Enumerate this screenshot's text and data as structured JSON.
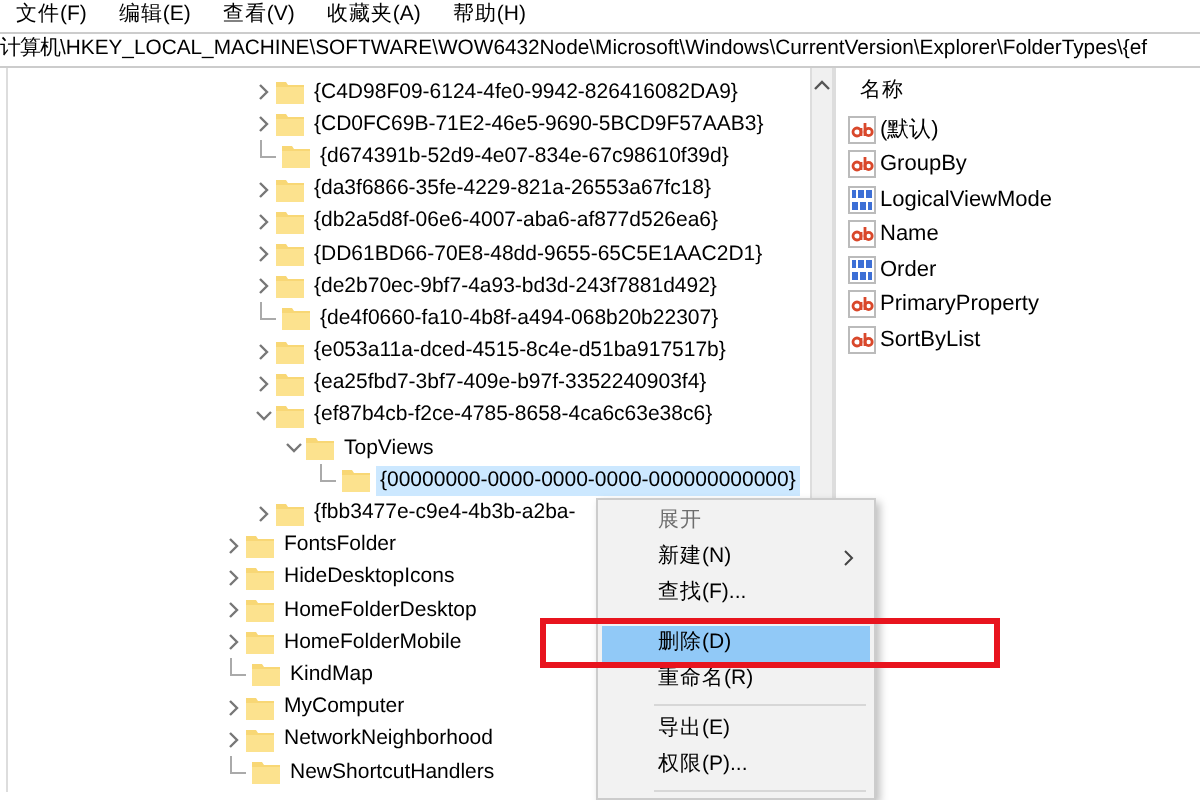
{
  "menu_bar": [
    "文件(F)",
    "编辑(E)",
    "查看(V)",
    "收藏夹(A)",
    "帮助(H)"
  ],
  "address": "计算机\\HKEY_LOCAL_MACHINE\\SOFTWARE\\WOW6432Node\\Microsoft\\Windows\\CurrentVersion\\Explorer\\FolderTypes\\{ef",
  "tree": {
    "continued": [
      {
        "label": "{C4D98F09-6124-4fe0-9942-826416082DA9}",
        "kind": "collapsed",
        "selected": false
      },
      {
        "label": "{CD0FC69B-71E2-46e5-9690-5BCD9F57AAB3}",
        "kind": "collapsed",
        "selected": false
      },
      {
        "label": "{d674391b-52d9-4e07-834e-67c98610f39d}",
        "kind": "leaf",
        "selected": false
      },
      {
        "label": "{da3f6866-35fe-4229-821a-26553a67fc18}",
        "kind": "collapsed",
        "selected": false
      },
      {
        "label": "{db2a5d8f-06e6-4007-aba6-af877d526ea6}",
        "kind": "collapsed",
        "selected": false
      },
      {
        "label": "{DD61BD66-70E8-48dd-9655-65C5E1AAC2D1}",
        "kind": "collapsed",
        "selected": false
      },
      {
        "label": "{de2b70ec-9bf7-4a93-bd3d-243f7881d492}",
        "kind": "collapsed",
        "selected": false
      },
      {
        "label": "{de4f0660-fa10-4b8f-a494-068b20b22307}",
        "kind": "leaf",
        "selected": false
      },
      {
        "label": "{e053a11a-dced-4515-8c4e-d51ba917517b}",
        "kind": "collapsed",
        "selected": false
      },
      {
        "label": "{ea25fbd7-3bf7-409e-b97f-3352240903f4}",
        "kind": "collapsed",
        "selected": false
      },
      {
        "label": "{ef87b4cb-f2ce-4785-8658-4ca6c63e38c6}",
        "kind": "expanded",
        "selected": false,
        "children": [
          {
            "label": "TopViews",
            "kind": "expanded",
            "selected": false,
            "children": [
              {
                "label": "{00000000-0000-0000-0000-000000000000}",
                "kind": "leaf",
                "selected": true
              }
            ]
          }
        ]
      },
      {
        "label": "{fbb3477e-c9e4-4b3b-a2ba-",
        "kind": "collapsed",
        "selected": false
      }
    ],
    "items": [
      {
        "label": "FontsFolder",
        "kind": "collapsed",
        "selected": false
      },
      {
        "label": "HideDesktopIcons",
        "kind": "collapsed",
        "selected": false
      },
      {
        "label": "HomeFolderDesktop",
        "kind": "collapsed",
        "selected": false
      },
      {
        "label": "HomeFolderMobile",
        "kind": "collapsed",
        "selected": false
      },
      {
        "label": "KindMap",
        "kind": "leaf",
        "selected": false
      },
      {
        "label": "MyComputer",
        "kind": "collapsed",
        "selected": false
      },
      {
        "label": "NetworkNeighborhood",
        "kind": "collapsed",
        "selected": false
      },
      {
        "label": "NewShortcutHandlers",
        "kind": "leaf",
        "selected": false
      }
    ]
  },
  "values": {
    "column": "名称",
    "rows": [
      {
        "name": "(默认)",
        "kind": "string"
      },
      {
        "name": "GroupBy",
        "kind": "string"
      },
      {
        "name": "LogicalViewMode",
        "kind": "binary"
      },
      {
        "name": "Name",
        "kind": "string"
      },
      {
        "name": "Order",
        "kind": "binary"
      },
      {
        "name": "PrimaryProperty",
        "kind": "string"
      },
      {
        "name": "SortByList",
        "kind": "string"
      }
    ]
  },
  "context_menu": [
    {
      "kind": "item",
      "label": "展开",
      "disabled": true,
      "submenu": false,
      "selected": false
    },
    {
      "kind": "item",
      "label": "新建(N)",
      "disabled": false,
      "submenu": true,
      "selected": false
    },
    {
      "kind": "item",
      "label": "查找(F)...",
      "disabled": false,
      "submenu": false,
      "selected": false
    },
    {
      "kind": "separator"
    },
    {
      "kind": "item",
      "label": "删除(D)",
      "disabled": false,
      "submenu": false,
      "selected": true
    },
    {
      "kind": "item",
      "label": "重命名(R)",
      "disabled": false,
      "submenu": false,
      "selected": false
    },
    {
      "kind": "separator"
    },
    {
      "kind": "item",
      "label": "导出(E)",
      "disabled": false,
      "submenu": false,
      "selected": false
    },
    {
      "kind": "item",
      "label": "权限(P)...",
      "disabled": false,
      "submenu": false,
      "selected": false
    },
    {
      "kind": "separator"
    }
  ]
}
